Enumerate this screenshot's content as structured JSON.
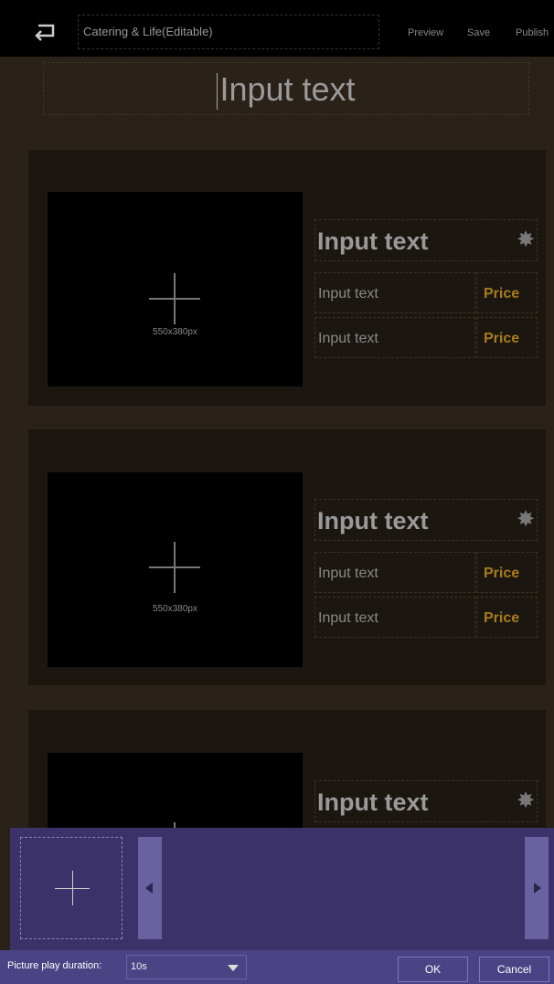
{
  "topbar": {
    "back_icon": "back-arrow-icon",
    "title": "Catering & Life(Editable)",
    "preview_label": "Preview",
    "save_label": "Save",
    "publish_label": "Publish"
  },
  "header": {
    "text": "Input text"
  },
  "cards": [
    {
      "image_size": "550x380px",
      "title": "Input text",
      "rows": [
        {
          "text": "Input text",
          "price": "Price"
        },
        {
          "text": "Input text",
          "price": "Price"
        }
      ]
    },
    {
      "image_size": "550x380px",
      "title": "Input text",
      "rows": [
        {
          "text": "Input text",
          "price": "Price"
        },
        {
          "text": "Input text",
          "price": "Price"
        }
      ]
    },
    {
      "title": "Input text"
    }
  ],
  "bottom": {
    "duration_label": "Picture play duration:",
    "duration_value": "10s",
    "ok_label": "OK",
    "cancel_label": "Cancel"
  },
  "colors": {
    "background": "#2a2218",
    "card": "#1c1610",
    "price": "#a67c1c",
    "panel": "#3a3268",
    "footer": "#4a4485"
  }
}
